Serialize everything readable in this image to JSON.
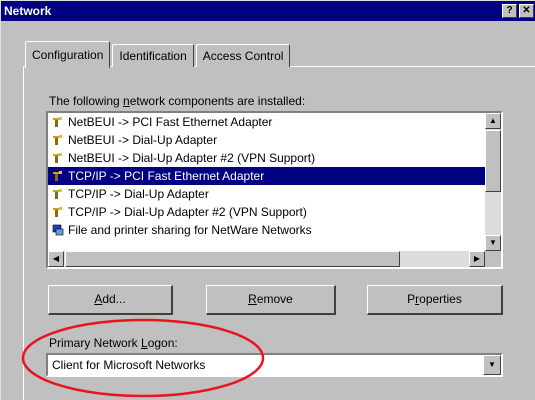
{
  "window": {
    "title": "Network",
    "help_button": "?",
    "close_button": "✕"
  },
  "tabs": [
    {
      "label": "Configuration",
      "active": true
    },
    {
      "label": "Identification",
      "active": false
    },
    {
      "label": "Access Control",
      "active": false
    }
  ],
  "components": {
    "label_before": "The following ",
    "label_key": "n",
    "label_after": "etwork components are installed:",
    "items": [
      {
        "label": "NetBEUI -> PCI Fast Ethernet Adapter",
        "icon": "protocol-icon",
        "selected": false
      },
      {
        "label": "NetBEUI -> Dial-Up Adapter",
        "icon": "protocol-icon",
        "selected": false
      },
      {
        "label": "NetBEUI -> Dial-Up Adapter #2 (VPN Support)",
        "icon": "protocol-icon",
        "selected": false
      },
      {
        "label": "TCP/IP -> PCI Fast Ethernet Adapter",
        "icon": "protocol-icon",
        "selected": true
      },
      {
        "label": "TCP/IP -> Dial-Up Adapter",
        "icon": "protocol-icon",
        "selected": false
      },
      {
        "label": "TCP/IP -> Dial-Up Adapter #2 (VPN Support)",
        "icon": "protocol-icon",
        "selected": false
      },
      {
        "label": "File and printer sharing for NetWare Networks",
        "icon": "file-sharing-icon",
        "selected": false
      }
    ]
  },
  "buttons": {
    "add": {
      "before": "",
      "key": "A",
      "after": "dd..."
    },
    "remove": {
      "before": "",
      "key": "R",
      "after": "emove"
    },
    "properties": {
      "before": "P",
      "key": "r",
      "after": "operties"
    }
  },
  "logon": {
    "label_before": "Primary Network ",
    "label_key": "L",
    "label_after": "ogon:",
    "value": "Client for Microsoft Networks"
  },
  "colors": {
    "titlebar": "#000080",
    "selection": "#000080",
    "face": "#c0c0c0",
    "annotation": "#e8141e"
  }
}
